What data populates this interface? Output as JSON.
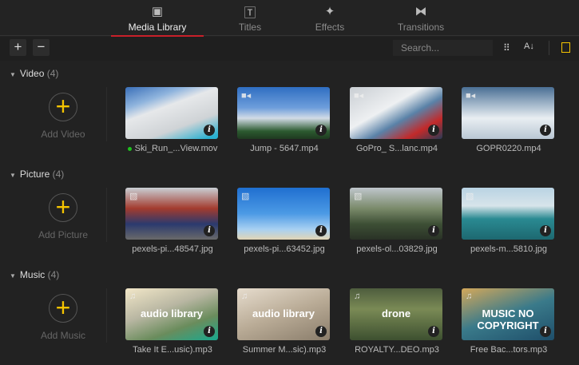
{
  "tabs": [
    {
      "label": "Media Library",
      "icon": "media-library-icon",
      "active": true
    },
    {
      "label": "Titles",
      "icon": "titles-icon"
    },
    {
      "label": "Effects",
      "icon": "effects-wand-icon"
    },
    {
      "label": "Transitions",
      "icon": "transitions-icon"
    }
  ],
  "toolbar": {
    "add": "+",
    "remove": "−",
    "search_placeholder": "Search..."
  },
  "accent": "#f5c400",
  "active_tab_color": "#c8202a",
  "sections": [
    {
      "title": "Video",
      "count": "(4)",
      "add_label": "Add Video",
      "items": [
        {
          "name": "Ski_Run_...View.mov",
          "in_use": true,
          "thumb": "linear-gradient(160deg,#3a6fb8 0%,#8fb4dd 25%,#e6e8ea 40%,#cfd3d6 70%,#2ab0d0 95%)"
        },
        {
          "name": "Jump - 5647.mp4",
          "thumb": "linear-gradient(180deg,#2f6ec2 0%,#6e9edb 40%,#d2dbe6 60%,#2c5a30 85%,#1f3a20 100%)"
        },
        {
          "name": "GoPro_ S...lanc.mp4",
          "thumb": "linear-gradient(150deg,#c9ced3 0%,#eef0f2 40%,#5a82a8 60%,#c22a2a 80%,#2a3a55 100%)"
        },
        {
          "name": "GOPR0220.mp4",
          "thumb": "linear-gradient(180deg,#4a6f94 0%,#9ab0c5 30%,#e9eef2 60%,#b9c7d4 100%)"
        }
      ]
    },
    {
      "title": "Picture",
      "count": "(4)",
      "add_label": "Add Picture",
      "items": [
        {
          "name": "pexels-pi...48547.jpg",
          "thumb": "linear-gradient(180deg,#c9cfd4 0%,#a33b2e 40%,#2b3a6e 70%,#6a6a6a 100%)"
        },
        {
          "name": "pexels-pi...63452.jpg",
          "thumb": "linear-gradient(180deg,#1f6fd0 0%,#4c9ae5 50%,#a7d0f2 80%,#e2d5b5 100%)"
        },
        {
          "name": "pexels-ol...03829.jpg",
          "thumb": "linear-gradient(180deg,#bfc6cc 0%,#7a8a6a 40%,#3d4f35 70%,#2a3226 100%)"
        },
        {
          "name": "pexels-m...5810.jpg",
          "thumb": "linear-gradient(180deg,#b9d3e3 0%,#d7e4ea 35%,#2a8a92 60%,#1d6870 100%)"
        }
      ]
    },
    {
      "title": "Music",
      "count": "(4)",
      "add_label": "Add Music",
      "items": [
        {
          "name": "Take It E...usic).mp3",
          "overlay": "audio library",
          "thumb": "linear-gradient(160deg,#f2e7c8 0%,#b8b6a2 40%,#6a8c5c 70%,#18a98f 100%)"
        },
        {
          "name": "Summer M...sic).mp3",
          "overlay": "audio library",
          "thumb": "linear-gradient(160deg,#e6dccd 0%,#b9ab96 50%,#8a7d6b 100%)"
        },
        {
          "name": "ROYALTY...DEO.mp3",
          "overlay": "drone",
          "thumb": "linear-gradient(180deg,#4e5d3e 0%,#7a8a55 40%,#3d5030 100%)"
        },
        {
          "name": "Free Bac...tors.mp3",
          "overlay": "MUSIC NO COPYRIGHT",
          "thumb": "linear-gradient(160deg,#d4a85a 0%,#3a7a8a 50%,#1e4e6a 100%)"
        }
      ]
    }
  ]
}
